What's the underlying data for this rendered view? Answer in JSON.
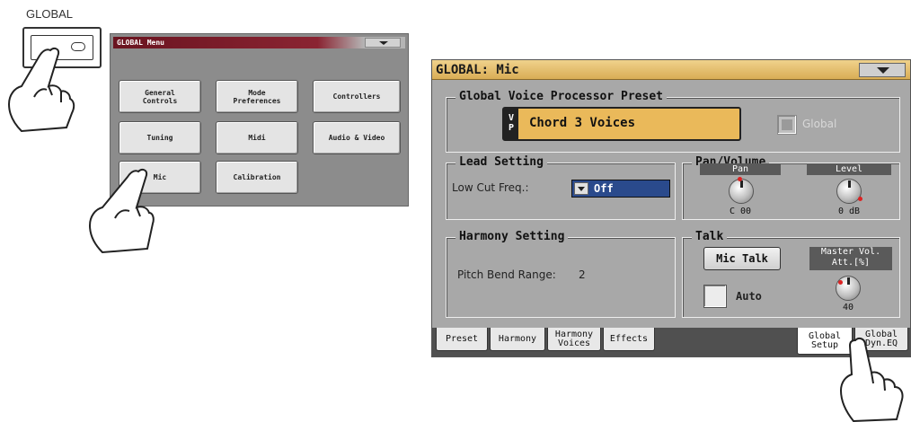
{
  "hardware": {
    "button_label": "GLOBAL"
  },
  "global_menu": {
    "title": "GLOBAL Menu",
    "buttons": [
      "General\nControls",
      "Mode\nPreferences",
      "Controllers",
      "Tuning",
      "Midi",
      "Audio & Video",
      "Mic",
      "Calibration"
    ]
  },
  "mic_page": {
    "title": "GLOBAL: Mic",
    "vp_preset": {
      "section_title": "Global Voice Processor Preset",
      "tag": "V\nP",
      "name": "Chord 3 Voices",
      "global_label": "Global"
    },
    "lead": {
      "section_title": "Lead Setting",
      "low_cut_label": "Low Cut Freq.:",
      "low_cut_value": "Off"
    },
    "pan_volume": {
      "section_title": "Pan/Volume",
      "pan_label": "Pan",
      "pan_value": "C 00",
      "level_label": "Level",
      "level_value": "0 dB"
    },
    "harmony": {
      "section_title": "Harmony Setting",
      "pitch_bend_label": "Pitch Bend Range:",
      "pitch_bend_value": "2"
    },
    "talk": {
      "section_title": "Talk",
      "mic_talk_label": "Mic Talk",
      "auto_label": "Auto",
      "master_vol_label": "Master Vol.\nAtt.[%]",
      "master_vol_value": "40"
    },
    "tabs": [
      "Preset",
      "Harmony",
      "Harmony\nVoices",
      "Effects",
      "Global\nSetup",
      "Global\nDyn.EQ"
    ]
  }
}
